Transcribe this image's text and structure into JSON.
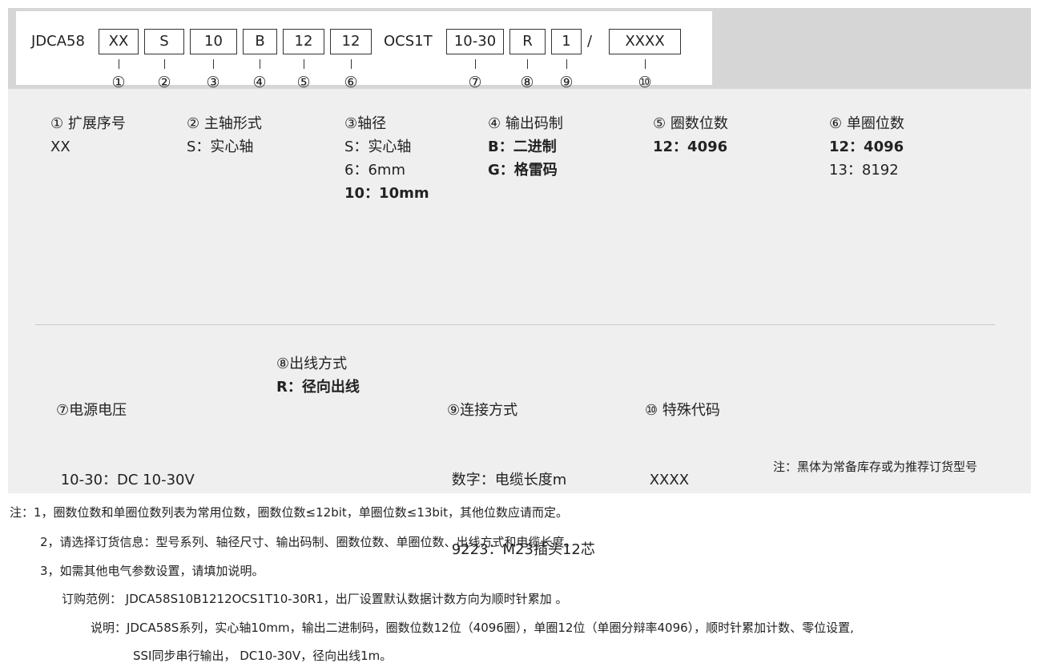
{
  "model": {
    "prefix": "JDCA58",
    "segments": [
      "XX",
      "S",
      "10",
      "B",
      "12",
      "12",
      "10-30",
      "R",
      "1",
      "XXXX"
    ],
    "middle_text": "OCS1T",
    "slash": "/",
    "numbers": [
      "①",
      "②",
      "③",
      "④",
      "⑤",
      "⑥",
      "⑦",
      "⑧",
      "⑨",
      "⑩"
    ]
  },
  "options_top": [
    {
      "title": "① 扩展序号",
      "lines": [
        {
          "text": "XX",
          "bold": false
        }
      ]
    },
    {
      "title": "② 主轴形式",
      "lines": [
        {
          "text": "S：实心轴",
          "bold": false
        }
      ]
    },
    {
      "title": "③轴径",
      "lines": [
        {
          "text": "S：实心轴",
          "bold": false
        },
        {
          "text": "6：6mm",
          "bold": false
        },
        {
          "text": "10：10mm",
          "bold": true
        }
      ]
    },
    {
      "title": "④ 输出码制",
      "lines": [
        {
          "text": "B：二进制",
          "bold": true
        },
        {
          "text": "G：格雷码",
          "bold": true
        }
      ]
    },
    {
      "title": "⑤ 圈数位数",
      "lines": [
        {
          "text": "12：4096",
          "bold": true
        }
      ]
    },
    {
      "title": "⑥ 单圈位数",
      "lines": [
        {
          "text": "12：4096",
          "bold": true
        },
        {
          "text": "13：8192",
          "bold": false
        }
      ]
    }
  ],
  "options_bottom": [
    {
      "title": "⑦电源电压",
      "lines": [
        {
          "text": " 10-30：DC 10-30V",
          "bold": false
        }
      ]
    },
    {
      "title": "⑧出线方式",
      "lines": [
        {
          "text": "R：径向出线",
          "bold": true
        }
      ]
    },
    {
      "title": "⑨连接方式",
      "lines": [
        {
          "text": " 数字：电缆长度m",
          "bold": false
        },
        {
          "text": " 9223：M23插头12芯",
          "bold": false
        }
      ]
    },
    {
      "title": "⑩ 特殊代码",
      "lines": [
        {
          "text": " XXXX",
          "bold": false
        }
      ]
    }
  ],
  "panel_note": "注：黑体为常备库存或为推荐订货型号",
  "footnotes": [
    "注：1，圈数位数和单圈位数列表为常用位数，圈数位数≤12bit，单圈位数≤13bit，其他位数应请而定。",
    "2，请选择订货信息：型号系列、轴径尺寸、输出码制、圈数位数、单圈位数、出线方式和电缆长度。",
    "3，如需其他电气参数设置，请填加说明。",
    "订购范例： JDCA58S10B1212OCS1T10-30R1，出厂设置默认数据计数方向为顺时针累加 。",
    "说明：JDCA58S系列，实心轴10mm，输出二进制码，圈数位数12位（4096圈），单圈12位（单圈分辩率4096），顺时针累加计数、零位设置,",
    "SSI同步串行输出， DC10-30V，径向出线1m。"
  ]
}
